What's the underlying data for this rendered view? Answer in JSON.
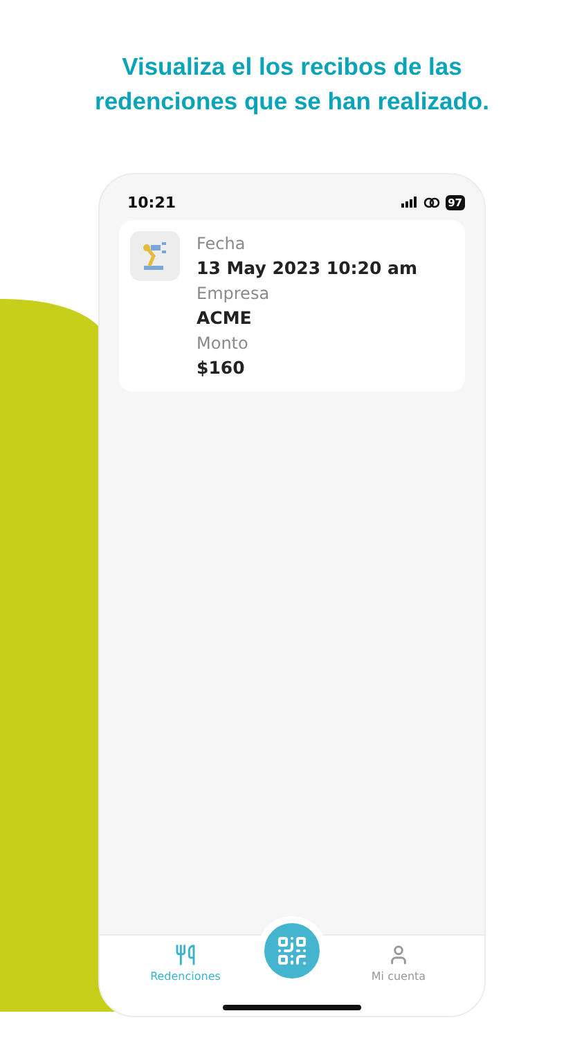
{
  "headline": "Visualiza el los recibos de las redenciones que se han realizado.",
  "status_bar": {
    "time": "10:21",
    "battery": "97"
  },
  "receipts": [
    {
      "fields": [
        {
          "label": "Fecha",
          "value": "13 May 2023 10:20 am"
        },
        {
          "label": "Empresa",
          "value": "ACME"
        },
        {
          "label": "Monto",
          "value": "$160"
        }
      ]
    }
  ],
  "tab_bar": [
    {
      "kind": "redemptions",
      "label": "Redenciones",
      "selected": true
    },
    {
      "kind": "scan",
      "selected": false
    },
    {
      "kind": "account",
      "label": "Mi cuenta",
      "selected": false
    }
  ]
}
